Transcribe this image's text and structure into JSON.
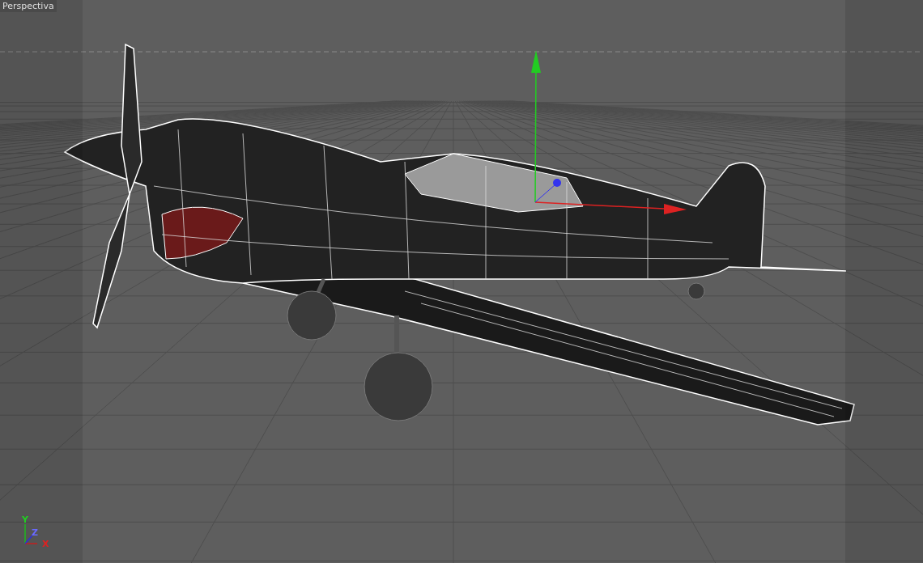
{
  "viewport": {
    "label": "Perspectiva"
  },
  "axis_indicator": [
    {
      "text": "Y",
      "color": "#22cc22"
    },
    {
      "text": "Z",
      "color": "#6a6aff"
    },
    {
      "text": "X",
      "color": "#dd2222"
    }
  ]
}
